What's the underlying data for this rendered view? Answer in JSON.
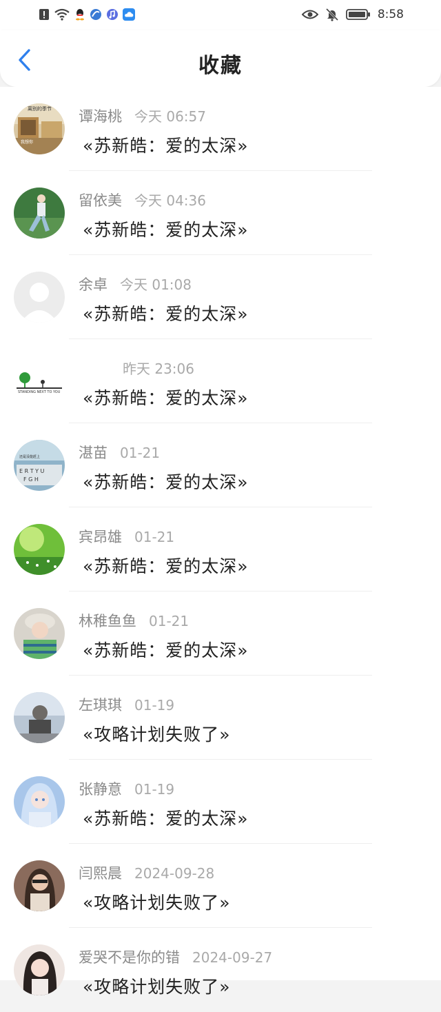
{
  "status_bar": {
    "time": "8:58",
    "icons": [
      "alert-icon",
      "wifi-icon",
      "qq-icon",
      "app-icon",
      "music-icon",
      "cloud-icon",
      "eye-icon",
      "mute-icon",
      "battery-icon"
    ]
  },
  "header": {
    "title": "收藏",
    "back_icon": "chevron-left-icon"
  },
  "colors": {
    "accent": "#2f80ed",
    "name": "#8a8a8a",
    "date": "#a9a9a9"
  },
  "favorites": [
    {
      "name": "谭海桃",
      "date": "今天 06:57",
      "message": "«苏新皓：爱的太深»"
    },
    {
      "name": "留依美",
      "date": "今天 04:36",
      "message": "«苏新皓：爱的太深»"
    },
    {
      "name": "余卓",
      "date": "今天 01:08",
      "message": "«苏新皓：爱的太深»"
    },
    {
      "name": "",
      "date": "昨天 23:06",
      "message": "«苏新皓：爱的太深»"
    },
    {
      "name": "湛苗",
      "date": "01-21",
      "message": "«苏新皓：爱的太深»"
    },
    {
      "name": "宾昂雄",
      "date": "01-21",
      "message": "«苏新皓：爱的太深»"
    },
    {
      "name": "林稚鱼鱼",
      "date": "01-21",
      "message": "«苏新皓：爱的太深»"
    },
    {
      "name": "左琪琪",
      "date": "01-19",
      "message": "«攻略计划失败了»"
    },
    {
      "name": "张静意",
      "date": "01-19",
      "message": "«苏新皓：爱的太深»"
    },
    {
      "name": "闫熙晨",
      "date": "2024-09-28",
      "message": "«攻略计划失败了»"
    },
    {
      "name": "爱哭不是你的错",
      "date": "2024-09-27",
      "message": "«攻略计划失败了»"
    }
  ]
}
